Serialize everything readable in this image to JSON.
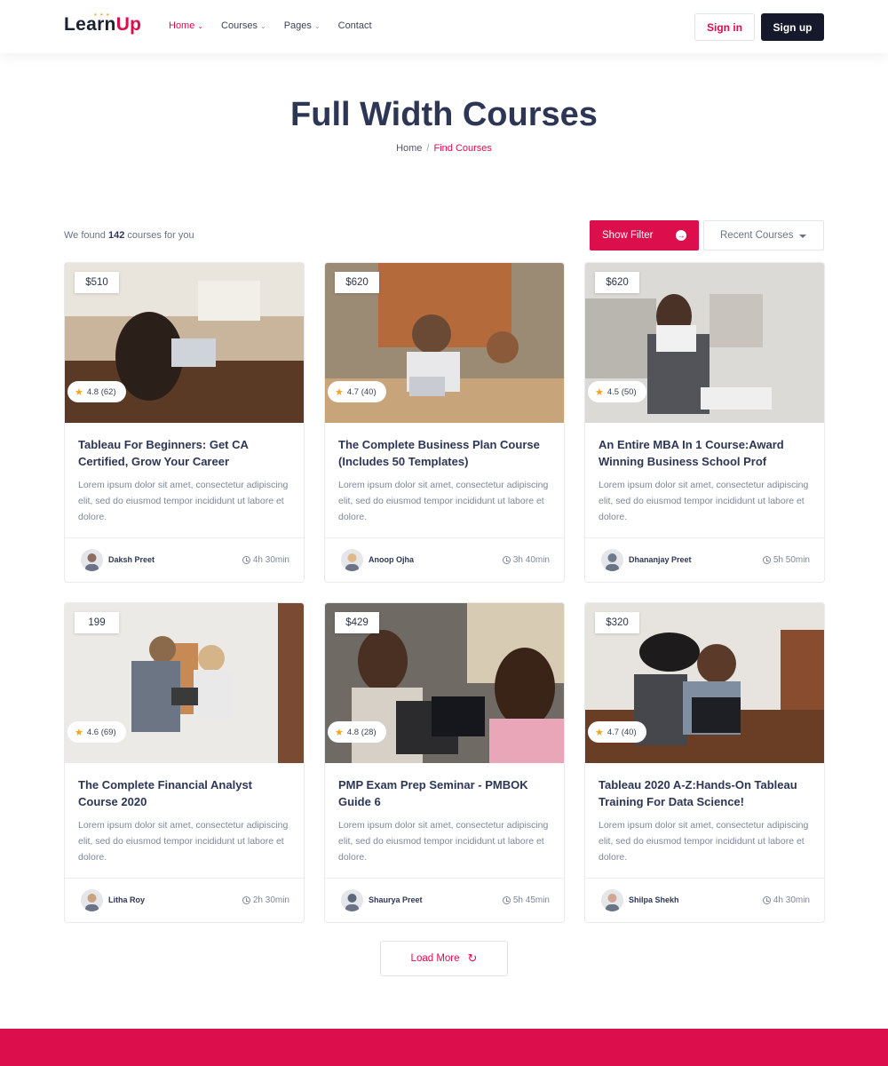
{
  "brand": {
    "part1": "Learn",
    "part2": "Up",
    "dots": "• • •"
  },
  "nav": [
    {
      "label": "Home",
      "dropdown": true,
      "active": true
    },
    {
      "label": "Courses",
      "dropdown": true,
      "active": false
    },
    {
      "label": "Pages",
      "dropdown": true,
      "active": false
    },
    {
      "label": "Contact",
      "dropdown": false,
      "active": false
    }
  ],
  "auth": {
    "signin": "Sign in",
    "signup": "Sign up"
  },
  "page": {
    "title": "Full Width Courses",
    "breadcrumb": {
      "home": "Home",
      "separator": "/",
      "current": "Find Courses"
    }
  },
  "toolbar": {
    "found_prefix": "We found",
    "found_count": "142",
    "found_suffix": "courses for you",
    "filter_label": "Show Filter",
    "sort_selected": "Recent Courses"
  },
  "courses": [
    {
      "price": "$510",
      "rating": "4.8 (62)",
      "title": "Tableau For Beginners: Get CA Certified, Grow Your Career",
      "desc": "Lorem ipsum dolor sit amet, consectetur adipiscing elit, sed do eiusmod tempor incididunt ut labore et dolore.",
      "author": "Daksh Preet",
      "duration": "4h 30min"
    },
    {
      "price": "$620",
      "rating": "4.7 (40)",
      "title": "The Complete Business Plan Course (Includes 50 Templates)",
      "desc": "Lorem ipsum dolor sit amet, consectetur adipiscing elit, sed do eiusmod tempor incididunt ut labore et dolore.",
      "author": "Anoop Ojha",
      "duration": "3h 40min"
    },
    {
      "price": "$620",
      "rating": "4.5 (50)",
      "title": "An Entire MBA In 1 Course:Award Winning Business School Prof",
      "desc": "Lorem ipsum dolor sit amet, consectetur adipiscing elit, sed do eiusmod tempor incididunt ut labore et dolore.",
      "author": "Dhananjay Preet",
      "duration": "5h 50min"
    },
    {
      "price": "199",
      "rating": "4.6 (69)",
      "title": "The Complete Financial Analyst Course 2020",
      "desc": "Lorem ipsum dolor sit amet, consectetur adipiscing elit, sed do eiusmod tempor incididunt ut labore et dolore.",
      "author": "Litha Roy",
      "duration": "2h 30min"
    },
    {
      "price": "$429",
      "rating": "4.8 (28)",
      "title": "PMP Exam Prep Seminar - PMBOK Guide 6",
      "desc": "Lorem ipsum dolor sit amet, consectetur adipiscing elit, sed do eiusmod tempor incididunt ut labore et dolore.",
      "author": "Shaurya Preet",
      "duration": "5h 45min"
    },
    {
      "price": "$320",
      "rating": "4.7 (40)",
      "title": "Tableau 2020 A-Z:Hands-On Tableau Training For Data Science!",
      "desc": "Lorem ipsum dolor sit amet, consectetur adipiscing elit, sed do eiusmod tempor incididunt ut labore et dolore.",
      "author": "Shilpa Shekh",
      "duration": "4h 30min"
    }
  ],
  "load_more": "Load More",
  "icons": {
    "caret": "chevron-down-icon",
    "filter": "arrow-right-circle-icon",
    "sort": "caret-down-icon",
    "star": "star-icon",
    "clock": "clock-icon",
    "refresh": "refresh-icon"
  },
  "colors": {
    "accent": "#dc0e4c",
    "dark": "#16192b",
    "title": "#2d3654",
    "star": "#f6a21a"
  }
}
